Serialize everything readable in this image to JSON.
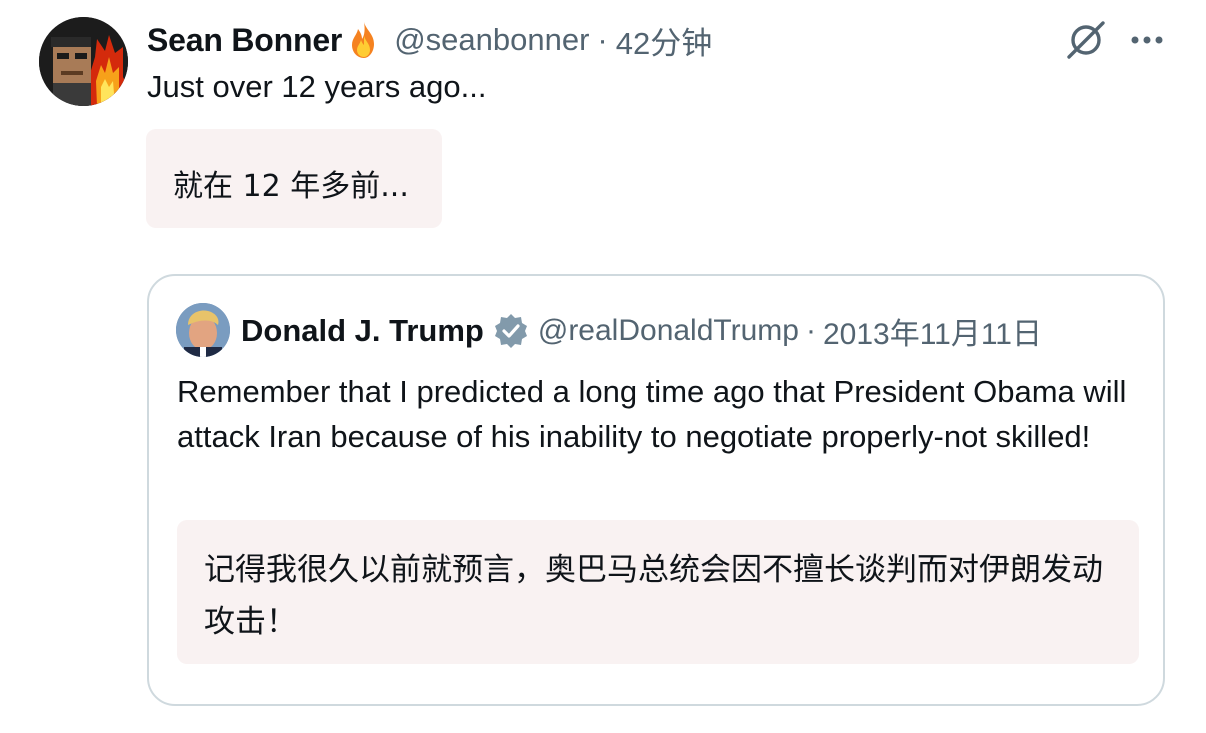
{
  "tweet": {
    "author_name": "Sean Bonner",
    "author_emoji": "fire-emoji",
    "handle": "@seanbonner",
    "separator": "·",
    "time": "42分钟",
    "text": "Just over 12 years ago...",
    "translation": "就在 12 年多前..."
  },
  "quoted_tweet": {
    "author_name": "Donald J. Trump",
    "verified_badge": "verified-badge-icon",
    "handle": "@realDonaldTrump",
    "separator": "·",
    "date": "2013年11月11日",
    "text": "Remember that I predicted a long time ago that President Obama will attack Iran because of his inability to negotiate properly-not skilled!",
    "translation": "记得我很久以前就预言，奥巴马总统会因不擅长谈判而对伊朗发动攻击！"
  },
  "icons": {
    "grok": "grok-icon",
    "more": "more-icon"
  },
  "colors": {
    "text_primary": "#0f1419",
    "text_secondary": "#536471",
    "translation_bg": "#f9f2f2",
    "border": "#cfd9de",
    "verified_badge": "#829aab"
  }
}
